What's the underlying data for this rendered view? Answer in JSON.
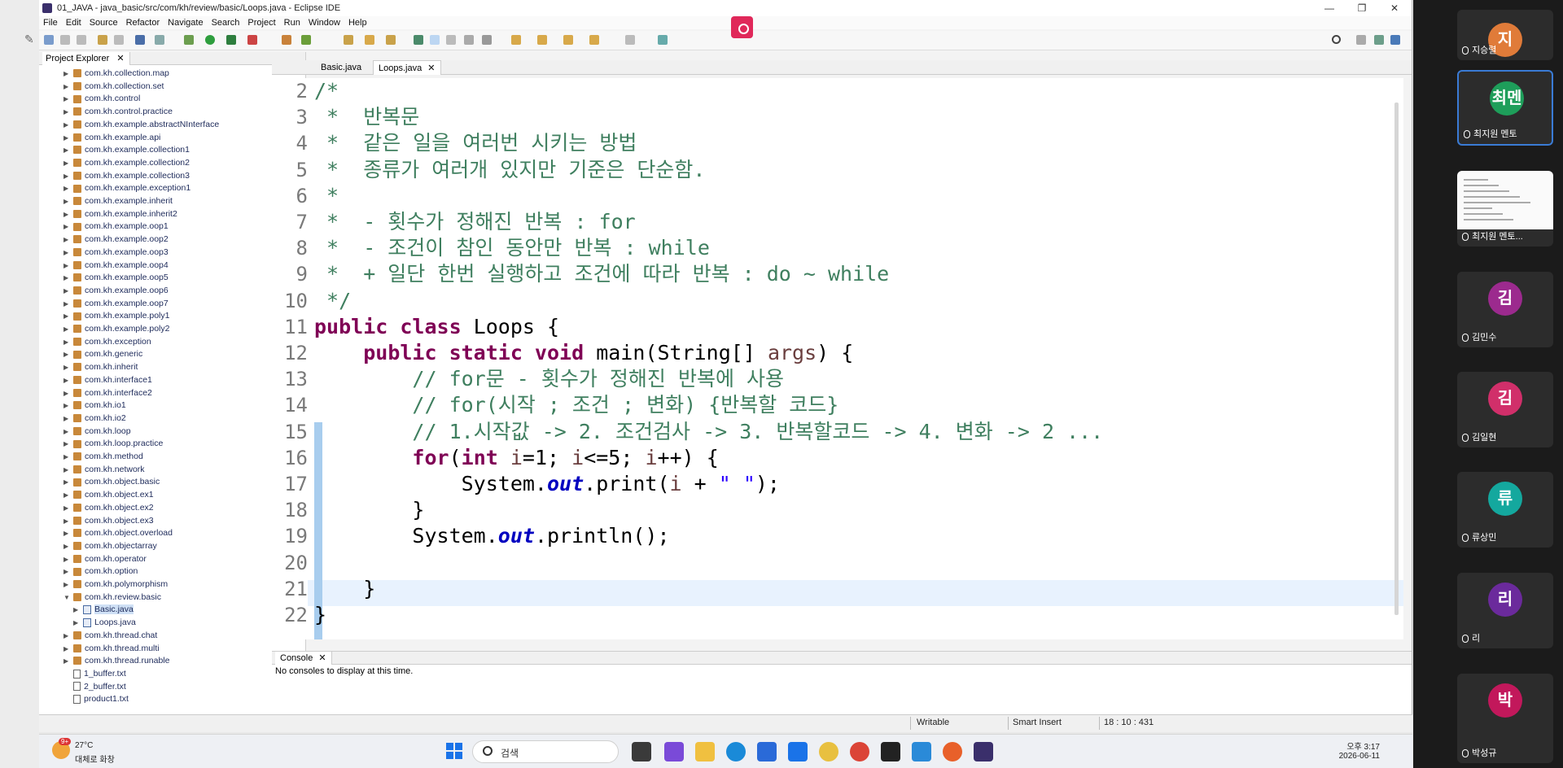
{
  "window": {
    "title": "01_JAVA - java_basic/src/com/kh/review/basic/Loops.java - Eclipse IDE",
    "minimize": "—",
    "maximize": "❐",
    "close": "✕"
  },
  "menu": [
    "File",
    "Edit",
    "Source",
    "Refactor",
    "Navigate",
    "Search",
    "Project",
    "Run",
    "Window",
    "Help"
  ],
  "explorer": {
    "title": "Project Explorer",
    "items": [
      {
        "label": "com.kh.collection.map",
        "kind": "pkg"
      },
      {
        "label": "com.kh.collection.set",
        "kind": "pkg"
      },
      {
        "label": "com.kh.control",
        "kind": "pkg"
      },
      {
        "label": "com.kh.control.practice",
        "kind": "pkg"
      },
      {
        "label": "com.kh.example.abstractNInterface",
        "kind": "pkg"
      },
      {
        "label": "com.kh.example.api",
        "kind": "pkg"
      },
      {
        "label": "com.kh.example.collection1",
        "kind": "pkg"
      },
      {
        "label": "com.kh.example.collection2",
        "kind": "pkg"
      },
      {
        "label": "com.kh.example.collection3",
        "kind": "pkg"
      },
      {
        "label": "com.kh.example.exception1",
        "kind": "pkg"
      },
      {
        "label": "com.kh.example.inherit",
        "kind": "pkg"
      },
      {
        "label": "com.kh.example.inherit2",
        "kind": "pkg"
      },
      {
        "label": "com.kh.example.oop1",
        "kind": "pkg"
      },
      {
        "label": "com.kh.example.oop2",
        "kind": "pkg"
      },
      {
        "label": "com.kh.example.oop3",
        "kind": "pkg"
      },
      {
        "label": "com.kh.example.oop4",
        "kind": "pkg"
      },
      {
        "label": "com.kh.example.oop5",
        "kind": "pkg"
      },
      {
        "label": "com.kh.example.oop6",
        "kind": "pkg"
      },
      {
        "label": "com.kh.example.oop7",
        "kind": "pkg"
      },
      {
        "label": "com.kh.example.poly1",
        "kind": "pkg"
      },
      {
        "label": "com.kh.example.poly2",
        "kind": "pkg"
      },
      {
        "label": "com.kh.exception",
        "kind": "pkg"
      },
      {
        "label": "com.kh.generic",
        "kind": "pkg"
      },
      {
        "label": "com.kh.inherit",
        "kind": "pkg"
      },
      {
        "label": "com.kh.interface1",
        "kind": "pkg"
      },
      {
        "label": "com.kh.interface2",
        "kind": "pkg"
      },
      {
        "label": "com.kh.io1",
        "kind": "pkg"
      },
      {
        "label": "com.kh.io2",
        "kind": "pkg"
      },
      {
        "label": "com.kh.loop",
        "kind": "pkg"
      },
      {
        "label": "com.kh.loop.practice",
        "kind": "pkg"
      },
      {
        "label": "com.kh.method",
        "kind": "pkg"
      },
      {
        "label": "com.kh.network",
        "kind": "pkg"
      },
      {
        "label": "com.kh.object.basic",
        "kind": "pkg"
      },
      {
        "label": "com.kh.object.ex1",
        "kind": "pkg"
      },
      {
        "label": "com.kh.object.ex2",
        "kind": "pkg"
      },
      {
        "label": "com.kh.object.ex3",
        "kind": "pkg"
      },
      {
        "label": "com.kh.object.overload",
        "kind": "pkg"
      },
      {
        "label": "com.kh.objectarray",
        "kind": "pkg"
      },
      {
        "label": "com.kh.operator",
        "kind": "pkg"
      },
      {
        "label": "com.kh.option",
        "kind": "pkg"
      },
      {
        "label": "com.kh.polymorphism",
        "kind": "pkg"
      },
      {
        "label": "com.kh.review.basic",
        "kind": "pkg-open"
      },
      {
        "label": "Basic.java",
        "kind": "java-selected"
      },
      {
        "label": "Loops.java",
        "kind": "java"
      },
      {
        "label": "com.kh.thread.chat",
        "kind": "pkg"
      },
      {
        "label": "com.kh.thread.multi",
        "kind": "pkg"
      },
      {
        "label": "com.kh.thread.runable",
        "kind": "pkg"
      },
      {
        "label": "1_buffer.txt",
        "kind": "file"
      },
      {
        "label": "2_buffer.txt",
        "kind": "file"
      },
      {
        "label": "product1.txt",
        "kind": "file"
      }
    ]
  },
  "editor": {
    "tabs": [
      {
        "label": "Basic.java",
        "active": false
      },
      {
        "label": "Loops.java",
        "active": true
      }
    ],
    "lines": [
      {
        "n": "2",
        "html": "<span class=\"cm\">/*</span>"
      },
      {
        "n": "3",
        "html": "<span class=\"cm\"> *  반복문</span>"
      },
      {
        "n": "4",
        "html": "<span class=\"cm\"> *  같은 일을 여러번 시키는 방법</span>"
      },
      {
        "n": "5",
        "html": "<span class=\"cm\"> *  종류가 여러개 있지만 기준은 단순함.</span>"
      },
      {
        "n": "6",
        "html": "<span class=\"cm\"> * </span>"
      },
      {
        "n": "7",
        "html": "<span class=\"cm\"> *  - 횟수가 정해진 반복 : for</span>"
      },
      {
        "n": "8",
        "html": "<span class=\"cm\"> *  - 조건이 참인 동안만 반복 : while</span>"
      },
      {
        "n": "9",
        "html": "<span class=\"cm\"> *  + 일단 한번 실행하고 조건에 따라 반복 : do ~ while</span>"
      },
      {
        "n": "10",
        "html": "<span class=\"cm\"> */</span>"
      },
      {
        "n": "11",
        "html": "<span class=\"kw\">public class</span> Loops {"
      },
      {
        "n": "12",
        "html": "    <span class=\"kw\">public static void</span> main(String[] <span class=\"vr\">args</span>) {"
      },
      {
        "n": "13",
        "html": "        <span class=\"cm\">// for문 - 횟수가 정해진 반복에 사용</span>"
      },
      {
        "n": "14",
        "html": "        <span class=\"cm\">// for(시작 ; 조건 ; 변화) {반복할 코드}</span>"
      },
      {
        "n": "15",
        "html": "        <span class=\"cm\">// 1.시작값 -&gt; 2. 조건검사 -&gt; 3. 반복할코드 -&gt; 4. 변화 -&gt; 2 ...</span>"
      },
      {
        "n": "16",
        "html": "        <span class=\"kw\">for</span>(<span class=\"kw\">int</span> <span class=\"vr\">i</span>=1; <span class=\"vr\">i</span>&lt;=5; <span class=\"vr\">i</span>++) {"
      },
      {
        "n": "17",
        "html": "            System.<span class=\"fld\">out</span>.print(<span class=\"vr\">i</span> + <span class=\"st\">\" \"</span>);"
      },
      {
        "n": "18",
        "html": "        }"
      },
      {
        "n": "19",
        "html": "        System.<span class=\"fld\">out</span>.println();"
      },
      {
        "n": "20",
        "html": ""
      },
      {
        "n": "21",
        "html": "    }"
      },
      {
        "n": "22",
        "html": "}"
      }
    ]
  },
  "console": {
    "title": "Console",
    "message": "No consoles to display at this time."
  },
  "status": {
    "writable": "Writable",
    "insert_mode": "Smart Insert",
    "position": "18 : 10 : 431"
  },
  "taskbar": {
    "weather_temp": "27°C",
    "weather_desc": "대체로 화창",
    "weather_badge": "9+",
    "search_label": "검색",
    "time": "오후 3:17",
    "date": "2026-06-11"
  },
  "participants": [
    {
      "initial": "지",
      "name": "지승렬",
      "color": "#e07b39",
      "kind": "avatar"
    },
    {
      "initial": "최멘",
      "name": "최지원 멘토",
      "color": "#1e9e5a",
      "kind": "avatar-active"
    },
    {
      "initial": "",
      "name": "최지원 멘토...",
      "color": "",
      "kind": "screen"
    },
    {
      "initial": "김",
      "name": "김민수",
      "color": "#9c2a8e",
      "kind": "avatar"
    },
    {
      "initial": "김",
      "name": "김일현",
      "color": "#d12f6a",
      "kind": "avatar"
    },
    {
      "initial": "류",
      "name": "류상민",
      "color": "#14a89e",
      "kind": "avatar"
    },
    {
      "initial": "리",
      "name": "리",
      "color": "#6b2a9c",
      "kind": "avatar"
    },
    {
      "initial": "박",
      "name": "박성규",
      "color": "#c2185b",
      "kind": "avatar"
    }
  ],
  "colors": {
    "record_button": "#e0285a",
    "current_line": "#e8f2fe",
    "keyword": "#7f0055",
    "comment": "#3f7f5f"
  }
}
